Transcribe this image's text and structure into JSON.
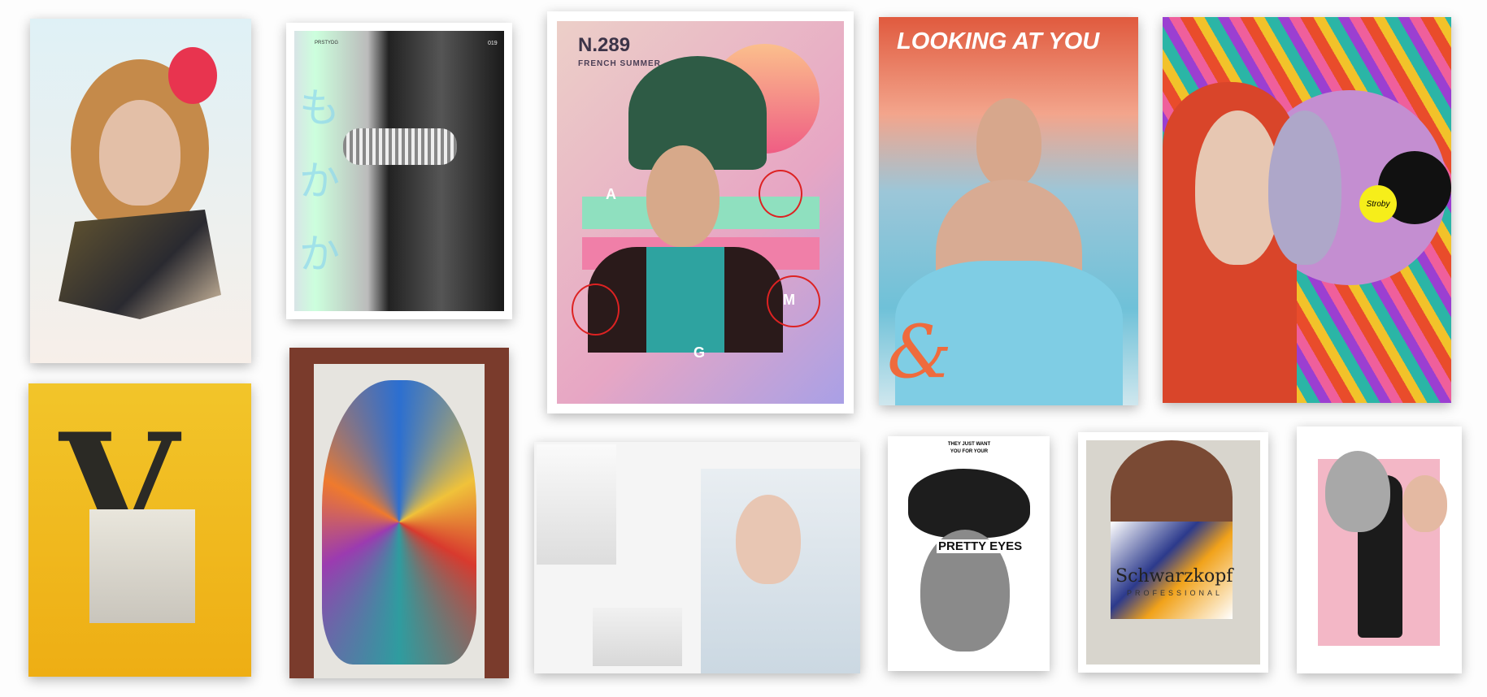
{
  "posters": {
    "collage_woman": {},
    "bw_woman": {
      "brand": "PRSTYDG",
      "number": "019",
      "glyphs": "もかか"
    },
    "french_summer": {
      "number": "N.289",
      "title": "FRENCH SUMMER",
      "letters": [
        "A",
        "G",
        "M"
      ]
    },
    "looking_at_you": {
      "title": "LOOKING AT YOU",
      "ampersand": "&"
    },
    "colorful_statue": {
      "badge": "Stroby"
    },
    "yellow_v": {
      "letter": "V"
    },
    "mural": {},
    "fashion_spread": {},
    "pretty_eyes": {
      "tagline": "THEY JUST WANT YOU FOR YOUR",
      "title": "PRETTY EYES"
    },
    "schwarzkopf": {
      "brand": "Schwarzkopf",
      "sub": "PROFESSIONAL"
    },
    "pink_collage": {}
  },
  "colors": {
    "background": "#fdfdfd",
    "yellow": "#f2b51c",
    "pink": "#f3b7c6",
    "mint": "#8fe0bf"
  }
}
